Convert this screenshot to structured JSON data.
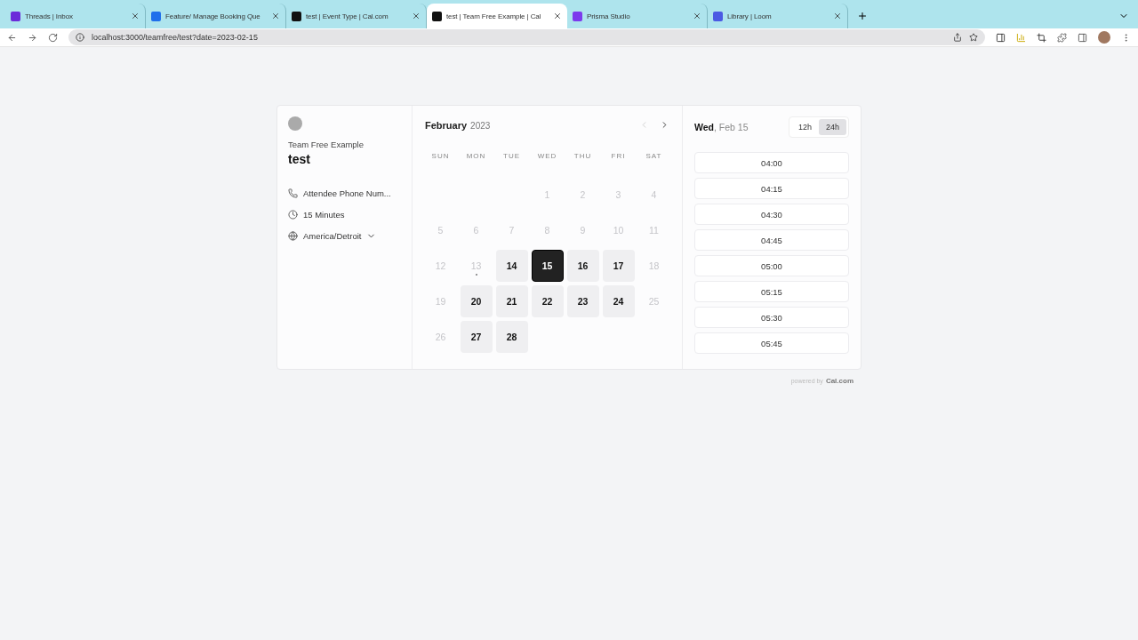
{
  "browser": {
    "tabs": [
      {
        "kind": "threads",
        "title": "Threads | Inbox",
        "selected": false
      },
      {
        "kind": "github",
        "title": "Feature/ Manage Booking Que",
        "selected": false
      },
      {
        "kind": "cal",
        "title": "test | Event Type | Cal.com",
        "selected": false
      },
      {
        "kind": "cal",
        "title": "test | Team Free Example | Cal",
        "selected": true
      },
      {
        "kind": "prisma",
        "title": "Prisma Studio",
        "selected": false
      },
      {
        "kind": "loom",
        "title": "Library | Loom",
        "selected": false
      }
    ],
    "url": "localhost:3000/teamfree/test?date=2023-02-15"
  },
  "profile": {
    "team": "Team Free Example",
    "event": "test",
    "details": [
      {
        "kind": "phone",
        "text": "Attendee Phone Num..."
      },
      {
        "kind": "clock",
        "text": "15 Minutes"
      },
      {
        "kind": "globe",
        "text": "America/Detroit"
      }
    ]
  },
  "calendar": {
    "month": "February",
    "year": "2023",
    "weekdays": [
      "SUN",
      "MON",
      "TUE",
      "WED",
      "THU",
      "FRI",
      "SAT"
    ],
    "weeks": [
      {
        "kind": "first",
        "days": [
          {
            "label": "1",
            "available": false,
            "selected": false,
            "today": false
          },
          {
            "label": "2",
            "available": false,
            "selected": false,
            "today": false
          },
          {
            "label": "3",
            "available": false,
            "selected": false,
            "today": false
          },
          {
            "label": "4",
            "available": false,
            "selected": false,
            "today": false
          }
        ]
      },
      {
        "kind": "full",
        "days": [
          {
            "label": "5",
            "available": false,
            "selected": false,
            "today": false
          },
          {
            "label": "6",
            "available": false,
            "selected": false,
            "today": false
          },
          {
            "label": "7",
            "available": false,
            "selected": false,
            "today": false
          },
          {
            "label": "8",
            "available": false,
            "selected": false,
            "today": false
          },
          {
            "label": "9",
            "available": false,
            "selected": false,
            "today": false
          },
          {
            "label": "10",
            "available": false,
            "selected": false,
            "today": false
          },
          {
            "label": "11",
            "available": false,
            "selected": false,
            "today": false
          }
        ]
      },
      {
        "kind": "full",
        "days": [
          {
            "label": "12",
            "available": false,
            "selected": false,
            "today": false
          },
          {
            "label": "13",
            "available": false,
            "selected": false,
            "today": true
          },
          {
            "label": "14",
            "available": true,
            "selected": false,
            "today": false
          },
          {
            "label": "15",
            "available": true,
            "selected": true,
            "today": false
          },
          {
            "label": "16",
            "available": true,
            "selected": false,
            "today": false
          },
          {
            "label": "17",
            "available": true,
            "selected": false,
            "today": false
          },
          {
            "label": "18",
            "available": false,
            "selected": false,
            "today": false
          }
        ]
      },
      {
        "kind": "full",
        "days": [
          {
            "label": "19",
            "available": false,
            "selected": false,
            "today": false
          },
          {
            "label": "20",
            "available": true,
            "selected": false,
            "today": false
          },
          {
            "label": "21",
            "available": true,
            "selected": false,
            "today": false
          },
          {
            "label": "22",
            "available": true,
            "selected": false,
            "today": false
          },
          {
            "label": "23",
            "available": true,
            "selected": false,
            "today": false
          },
          {
            "label": "24",
            "available": true,
            "selected": false,
            "today": false
          },
          {
            "label": "25",
            "available": false,
            "selected": false,
            "today": false
          }
        ]
      },
      {
        "kind": "last",
        "days": [
          {
            "label": "26",
            "available": false,
            "selected": false,
            "today": false
          },
          {
            "label": "27",
            "available": true,
            "selected": false,
            "today": false
          },
          {
            "label": "28",
            "available": true,
            "selected": false,
            "today": false
          }
        ]
      }
    ]
  },
  "slots": {
    "weekday": "Wed",
    "date": ", Feb 15",
    "formats": [
      {
        "label": "12h",
        "selected": false
      },
      {
        "label": "24h",
        "selected": true
      }
    ],
    "times": [
      "04:00",
      "04:15",
      "04:30",
      "04:45",
      "05:00",
      "05:15",
      "05:30",
      "05:45"
    ]
  },
  "footer": {
    "prefix": "powered by",
    "brand": "Cal.com"
  }
}
